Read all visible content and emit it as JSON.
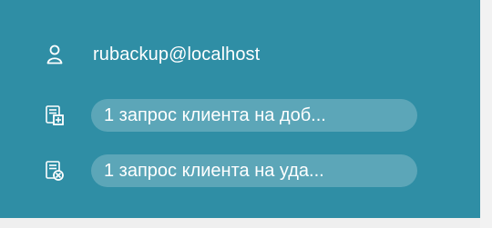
{
  "panel": {
    "bg_color": "#2f8ea5",
    "user": {
      "icon": "user-icon",
      "label": "rubackup@localhost"
    },
    "notifications": [
      {
        "icon": "document-add-icon",
        "label": "1 запрос клиента на доб..."
      },
      {
        "icon": "document-remove-icon",
        "label": "1 запрос клиента на уда..."
      }
    ]
  }
}
